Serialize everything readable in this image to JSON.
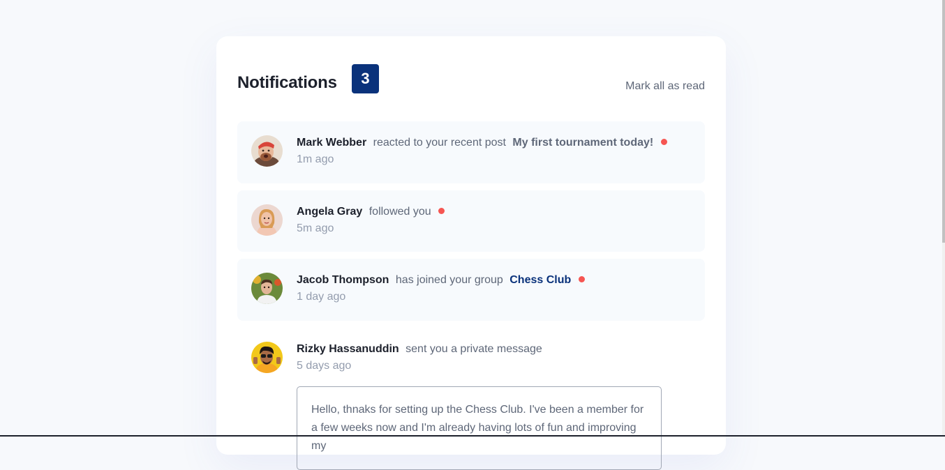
{
  "header": {
    "title": "Notifications",
    "unread_count": "3",
    "mark_all_label": "Mark all as read"
  },
  "notifications": [
    {
      "name": "Mark Webber",
      "action": "reacted to your recent post",
      "target": "My first tournament today!",
      "time": "1m ago",
      "unread": true
    },
    {
      "name": "Angela Gray",
      "action": "followed you",
      "time": "5m ago",
      "unread": true
    },
    {
      "name": "Jacob Thompson",
      "action": "has joined your group",
      "target": "Chess Club",
      "time": "1 day ago",
      "unread": true
    },
    {
      "name": "Rizky Hassanuddin",
      "action": "sent you a private message",
      "time": "5 days ago",
      "unread": false,
      "message": "Hello, thnaks for setting up the Chess Club. I've been a member for a few weeks now and I'm already having lots of fun and improving my"
    }
  ],
  "colors": {
    "background": "#f7f9fc",
    "unread_background": "#f7fafd",
    "badge": "#0a327b",
    "dot": "#f65552",
    "heading": "#1c202b",
    "group_link": "#0a327b"
  },
  "icons": {
    "avatars": [
      "avatar-mark-webber",
      "avatar-angela-gray",
      "avatar-jacob-thompson",
      "avatar-rizky-hassanuddin"
    ],
    "unread_indicator": "red-dot-icon"
  }
}
